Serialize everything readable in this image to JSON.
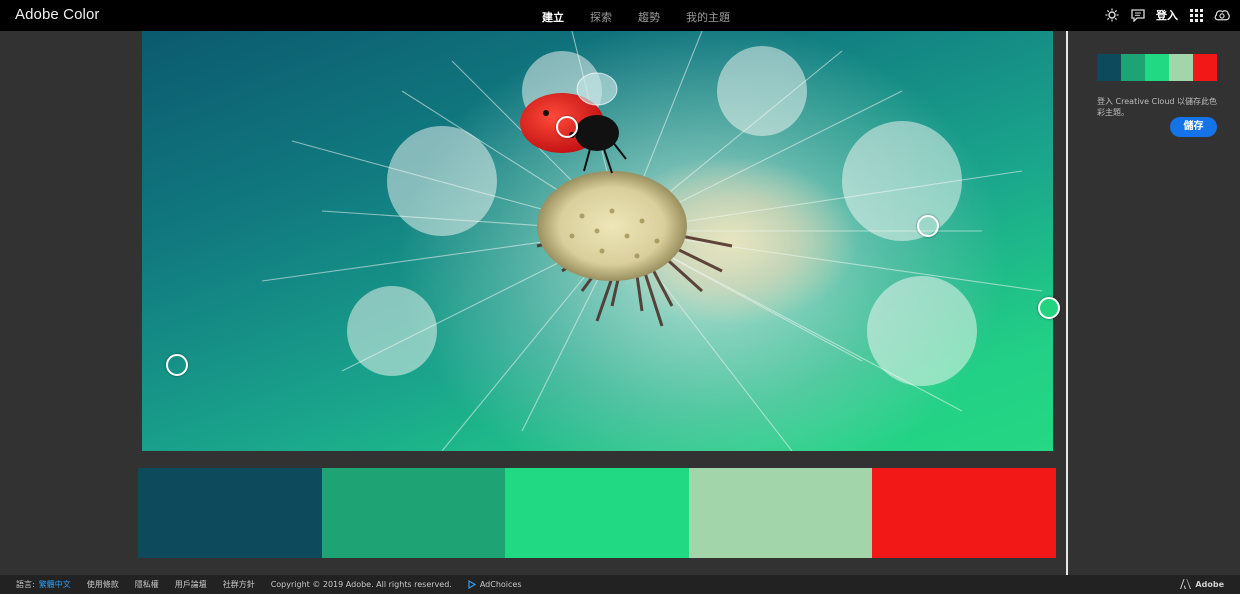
{
  "app": {
    "title": "Adobe Color"
  },
  "nav": {
    "items": [
      {
        "label": "建立",
        "active": true
      },
      {
        "label": "探索",
        "active": false
      },
      {
        "label": "趨勢",
        "active": false
      },
      {
        "label": "我的主題",
        "active": false
      }
    ]
  },
  "topbar": {
    "signin_label": "登入",
    "icons": [
      "brightness-icon",
      "feedback-icon",
      "apps-grid-icon",
      "creative-cloud-icon"
    ]
  },
  "theme": {
    "colors": [
      "#0c4a5c",
      "#1ea474",
      "#21d883",
      "#a3d5aa",
      "#f21818"
    ]
  },
  "panel": {
    "cc_message": "登入 Creative Cloud 以儲存此色彩主題。",
    "save_label": "儲存"
  },
  "footer": {
    "language_label": "語言:",
    "language_value": "繁體中文",
    "links": [
      "使用條款",
      "隱私權",
      "用戶論壇",
      "社群方針"
    ],
    "copyright": "Copyright © 2019 Adobe. All rights reserved.",
    "adchoices": "AdChoices",
    "adobe": "Adobe"
  }
}
